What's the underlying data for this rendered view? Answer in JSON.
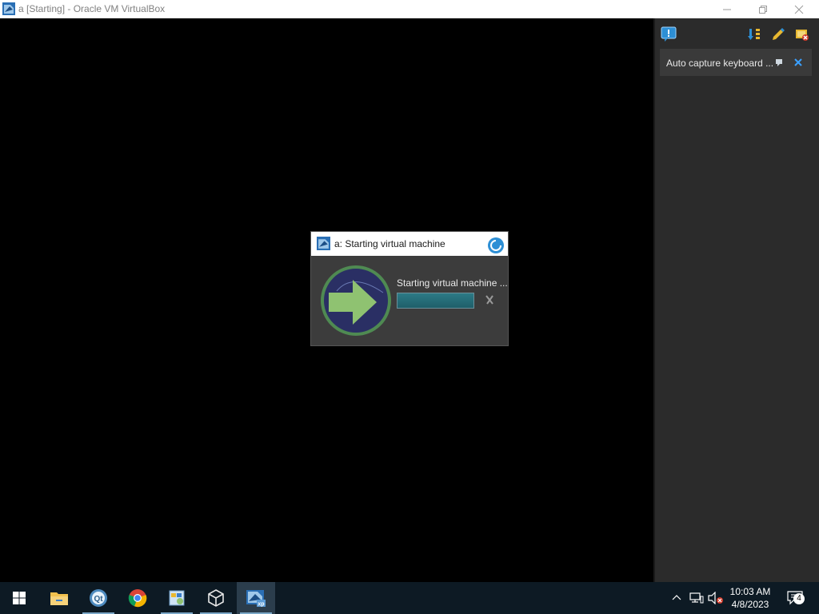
{
  "window": {
    "title": "a [Starting] - Oracle VM VirtualBox",
    "app_icon": "virtualbox-vm-icon",
    "controls": [
      "minimize-icon",
      "restore-icon",
      "close-icon"
    ]
  },
  "side_panel": {
    "top_icons": [
      "message-icon",
      "sort-icon",
      "edit-icon",
      "vm-settings-icon"
    ],
    "notification": {
      "text": "Auto capture keyboard ...",
      "actions": [
        "help-icon",
        "close-icon"
      ]
    }
  },
  "dialog": {
    "title": "a: Starting virtual machine",
    "message": "Starting virtual machine ...",
    "progress": 1.0,
    "cancel_icon": "cancel-x-icon",
    "accent": "#2c7a86"
  },
  "taskbar": {
    "apps": [
      {
        "name": "start-button",
        "icon": "windows-logo-icon"
      },
      {
        "name": "file-explorer",
        "icon": "folder-icon"
      },
      {
        "name": "qt-app",
        "icon": "qt-icon"
      },
      {
        "name": "chrome",
        "icon": "chrome-icon"
      },
      {
        "name": "paint-app",
        "icon": "paint-icon"
      },
      {
        "name": "virtualbox-manager",
        "icon": "virtualbox-icon"
      },
      {
        "name": "vm-window",
        "icon": "xp-vm-icon"
      }
    ],
    "tray": {
      "time": "10:03 AM",
      "date": "4/8/2023",
      "notification_count": "4"
    }
  },
  "colors": {
    "taskbar_bg": "#0d1a24",
    "panel_bg": "#2b2b2b",
    "dialog_bg": "#3c3c3c"
  }
}
